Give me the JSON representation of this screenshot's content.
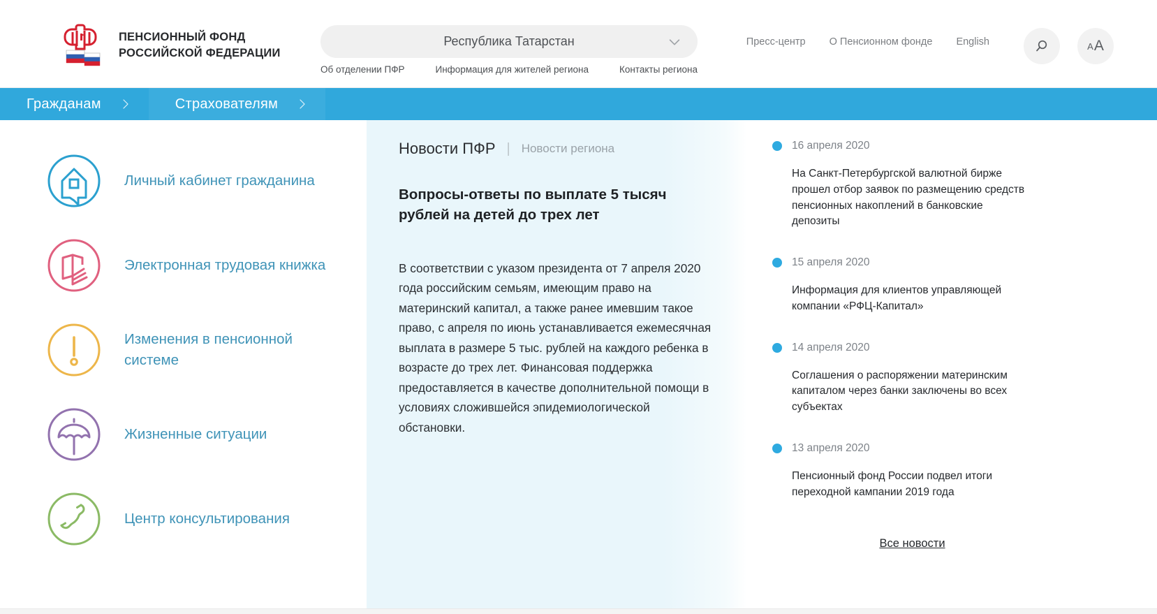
{
  "header": {
    "logo": {
      "icon": "pfr-emblem-icon",
      "line1": "ПЕНСИОННЫЙ ФОНД",
      "line2": "РОССИЙСКОЙ ФЕДЕРАЦИИ"
    },
    "region_select": {
      "icon": "chevron-down-icon",
      "value": "Республика Татарстан"
    },
    "region_subnav": [
      {
        "label": "Об отделении  ПФР"
      },
      {
        "label": "Информация для жителей региона"
      },
      {
        "label": "Контакты региона"
      }
    ],
    "top_links": [
      {
        "label": "Пресс-центр"
      },
      {
        "label": "О Пенсионном фонде"
      },
      {
        "label": "English"
      }
    ],
    "search_button": {
      "icon": "search-icon",
      "label": ""
    },
    "fontsize_button": {
      "icon": "font-size-icon",
      "small": "A",
      "big": "A"
    }
  },
  "blue_nav": {
    "background": "#30a8dc",
    "items": [
      {
        "label": "Гражданам",
        "icon": "chevron-right-icon"
      },
      {
        "label": "Страхователям",
        "icon": "chevron-right-icon"
      }
    ]
  },
  "sidebar": {
    "items": [
      {
        "label": "Личный кабинет гражданина",
        "icon": "house-in-circle-icon",
        "color": "#2ba0cf"
      },
      {
        "label": "Электронная трудовая книжка",
        "icon": "book-in-circle-icon",
        "color": "#e0607f"
      },
      {
        "label": "Изменения в пенсионной системе",
        "icon": "exclamation-in-circle-icon",
        "color": "#edb64a"
      },
      {
        "label": "Жизненные ситуации",
        "icon": "umbrella-in-circle-icon",
        "color": "#9272ae"
      },
      {
        "label": "Центр консультирования",
        "icon": "phone-in-circle-icon",
        "color": "#8bba65"
      }
    ]
  },
  "center": {
    "tabs": {
      "active": "Новости ПФР",
      "separator": "|",
      "inactive": "Новости региона"
    },
    "feature": {
      "title": "Вопросы-ответы по выплате 5 тысяч рублей на детей до трех лет",
      "body": "В соответствии с указом президента от 7 апреля 2020 года российским семьям, имеющим право на материнский капитал, а также ранее имевшим такое право, с апреля по июнь устанавливается ежемесячная выплата в размере 5 тыс. рублей на каждого ребенка в возрасте до трех лет. Финансовая поддержка предоставляется в качестве дополнительной помощи в условиях сложившейся эпидемиологической обстановки."
    }
  },
  "news": {
    "dot_color": "#2eaae0",
    "items": [
      {
        "date": "16 апреля 2020",
        "title": "На Санкт-Петербургской валютной бирже прошел отбор заявок по размещению средств пенсионных накоплений в банковские депозиты"
      },
      {
        "date": "15 апреля 2020",
        "title": "Информация для клиентов управляющей компании «РФЦ-Капитал»"
      },
      {
        "date": "14 апреля 2020",
        "title": "Соглашения о распоряжении материнским капиталом через банки заключены во всех субъектах"
      },
      {
        "date": "13 апреля 2020",
        "title": "Пенсионный фонд России подвел итоги переходной кампании 2019 года"
      }
    ],
    "all_news_label": "Все новости"
  }
}
